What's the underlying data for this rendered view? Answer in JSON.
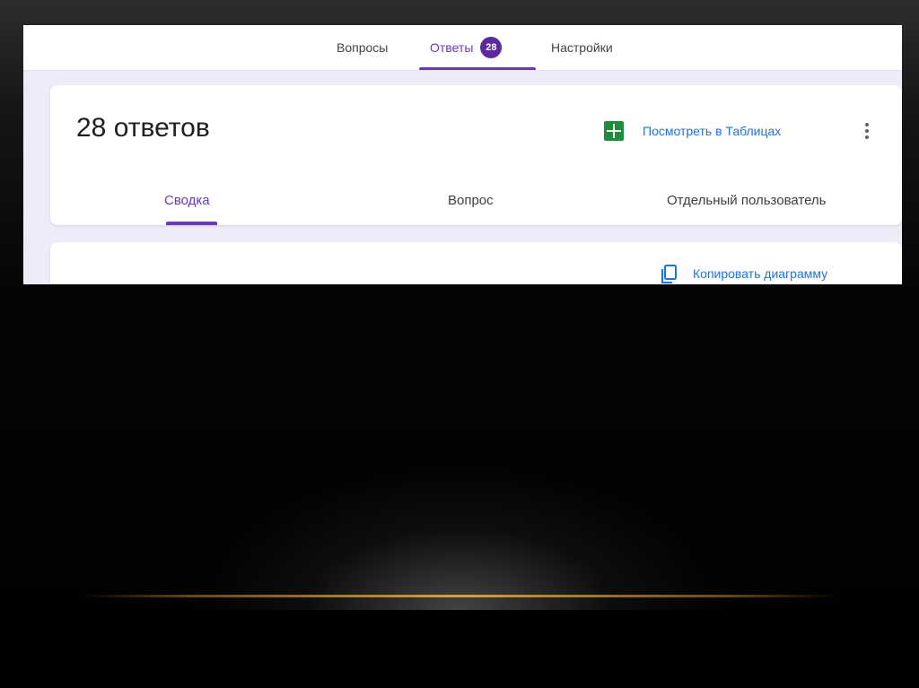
{
  "top_tabs": {
    "questions": "Вопросы",
    "responses": "Ответы",
    "responses_badge": "28",
    "settings": "Настройки"
  },
  "summary_card": {
    "title": "28 ответов",
    "sheets_link": "Посмотреть в Таблицах",
    "sub_tabs": {
      "summary": "Сводка",
      "question": "Вопрос",
      "individual": "Отдельный пользователь"
    }
  },
  "chart_card": {
    "copy_link": "Копировать диаграмму"
  },
  "icons": {
    "sheets": "sheets-icon",
    "more": "more-vert-icon",
    "copy": "copy-icon"
  },
  "colors": {
    "accent": "#673ab7",
    "link": "#1a73e8",
    "sheets_green": "#1e8e3e",
    "page_bg": "#f0ebf8"
  }
}
